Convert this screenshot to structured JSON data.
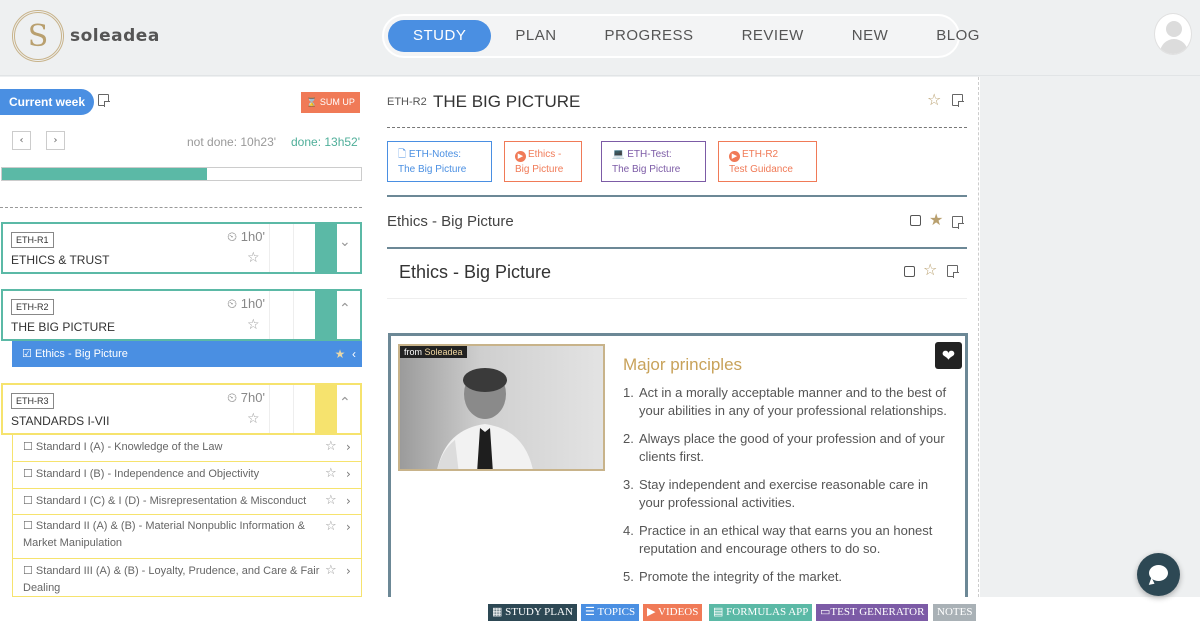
{
  "brand": {
    "name": "soleadea",
    "logo_letter": "S"
  },
  "nav": [
    {
      "label": "STUDY",
      "active": true
    },
    {
      "label": "PLAN"
    },
    {
      "label": "PROGRESS"
    },
    {
      "label": "REVIEW"
    },
    {
      "label": "NEW"
    },
    {
      "label": "BLOG"
    }
  ],
  "sidebar": {
    "week_label": "Current week",
    "sumup_label": "SUM UP",
    "prev_label": "‹",
    "next_label": "›",
    "not_done": "not done: 10h23'",
    "done": "done: 13h52'",
    "progress_fraction": 0.57,
    "modules": [
      {
        "code": "ETH-R1",
        "title": "ETHICS & TRUST",
        "duration": "1h0'",
        "color": "teal",
        "chevron": "⌄"
      },
      {
        "code": "ETH-R2",
        "title": "THE BIG PICTURE",
        "duration": "1h0'",
        "color": "teal",
        "chevron": "⌃"
      },
      {
        "code": "ETH-R3",
        "title": "STANDARDS I-VII",
        "duration": "7h0'",
        "color": "yellow",
        "chevron": "⌃"
      }
    ],
    "active_sub": "Ethics - Big Picture",
    "standards": [
      {
        "l1": "Standard I (A) - Knowledge of the Law",
        "l2": ""
      },
      {
        "l1": "Standard I (B) - Independence and Objectivity",
        "l2": ""
      },
      {
        "l1": "Standard I (C) & I (D) - Misrepresentation & Misconduct",
        "l2": ""
      },
      {
        "l1": "Standard II (A) & (B) - Material Nonpublic Information &",
        "l2": "Market Manipulation"
      },
      {
        "l1": "Standard III (A) & (B) - Loyalty, Prudence, and Care & Fair",
        "l2": "Dealing"
      }
    ]
  },
  "main": {
    "code": "ETH-R2",
    "title": "THE BIG PICTURE",
    "resources": [
      {
        "line1": "ETH-Notes:",
        "line2": "The Big Picture",
        "type": "pdf",
        "color": "#4a8fe2"
      },
      {
        "line1": "Ethics -",
        "line2": "Big Picture",
        "type": "video",
        "color": "#f07a57"
      },
      {
        "line1": "ETH-Test:",
        "line2": "The Big Picture",
        "type": "test",
        "color": "#7c5ba6"
      },
      {
        "line1": "ETH-R2",
        "line2": "Test Guidance",
        "type": "video",
        "color": "#f07a57"
      }
    ],
    "section_title": "Ethics - Big Picture",
    "lesson_title": "Ethics - Big Picture",
    "video": {
      "tag_from": "from",
      "tag_brand": "Soleadea",
      "heading": "Major principles",
      "principles": [
        {
          "n": "1.",
          "text": "Act in a morally acceptable manner and to the best of your abilities in any of your professional relationships."
        },
        {
          "n": "2.",
          "text": "Always place the good of your profession and of your clients first."
        },
        {
          "n": "3.",
          "text": "Stay independent and  exercise reasonable care in your professional activities."
        },
        {
          "n": "4.",
          "text": "Practice in an ethical way that earns you an honest reputation and encourage others to do so."
        },
        {
          "n": "5.",
          "text": "Promote the integrity of the market."
        }
      ]
    }
  },
  "bottom_bar": [
    {
      "label": "STUDY PLAN",
      "color": "#2d4854",
      "icon": "calendar-icon"
    },
    {
      "label": "TOPICS",
      "color": "#4a8fe2",
      "icon": "list-icon"
    },
    {
      "label": "VIDEOS",
      "color": "#f07a57",
      "icon": "play-icon"
    },
    {
      "label": "FORMULAS APP",
      "color": "#5bb9a6",
      "icon": "calculator-icon"
    },
    {
      "label": "TEST GENERATOR",
      "color": "#7c5ba6",
      "icon": "laptop-icon"
    },
    {
      "label": "NOTES",
      "color": "#a9b1b6",
      "icon": ""
    }
  ]
}
